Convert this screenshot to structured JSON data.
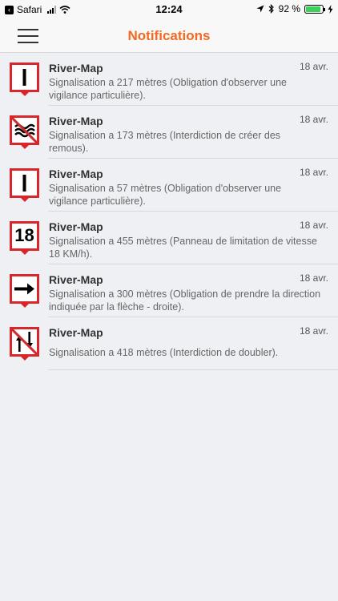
{
  "status_bar": {
    "carrier": "Safari",
    "time": "12:24",
    "battery": "92 %",
    "battery_level": 0.92
  },
  "nav": {
    "title": "Notifications",
    "menu_icon": "hamburger-icon"
  },
  "notifications": [
    {
      "title": "River-Map",
      "date": "18 avr.",
      "text": "Signalisation a 217 mètres (Obligation d'observer une vigilance particulière).",
      "icon": "vigilance-sign-icon"
    },
    {
      "title": "River-Map",
      "date": "18 avr.",
      "text": "Signalisation a 173 mètres (Interdiction de créer des remous).",
      "icon": "no-wash-sign-icon"
    },
    {
      "title": "River-Map",
      "date": "18 avr.",
      "text": "Signalisation a 57 mètres (Obligation d'observer une vigilance particulière).",
      "icon": "vigilance-sign-icon"
    },
    {
      "title": "River-Map",
      "date": "18 avr.",
      "text": "Signalisation a 455 mètres (Panneau de limitation de vitesse 18 KM/h).",
      "icon": "speed-limit-sign-icon",
      "sign_text": "18"
    },
    {
      "title": "River-Map",
      "date": "18 avr.",
      "text": "Signalisation a 300 mètres (Obligation de prendre la direction indiquée par la flèche - droite).",
      "icon": "arrow-right-sign-icon"
    },
    {
      "title": "River-Map",
      "date": "18 avr.",
      "text": "Signalisation a 418 mètres (Interdiction de doubler).",
      "icon": "no-overtaking-sign-icon"
    }
  ],
  "colors": {
    "accent": "#f06a22",
    "sign_red": "#d9262b",
    "background": "#eef0f4"
  }
}
